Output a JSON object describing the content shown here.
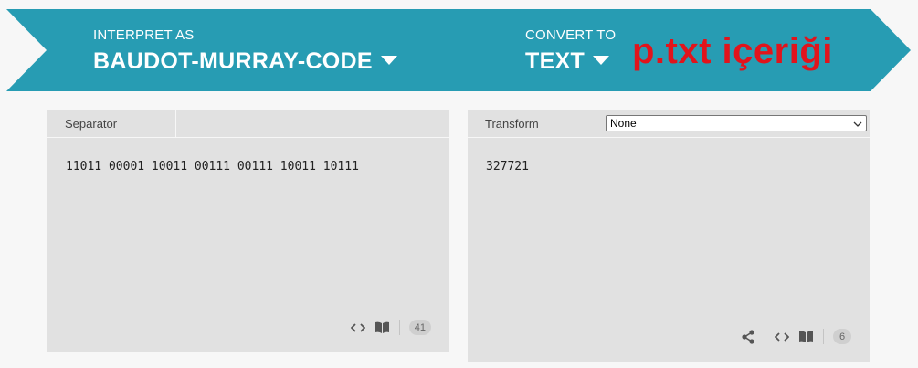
{
  "banner": {
    "interpret_label": "INTERPRET AS",
    "interpret_value": "BAUDOT-MURRAY-CODE",
    "convert_label": "CONVERT TO",
    "convert_value": "TEXT",
    "overlay_text": "p.txt içeriği",
    "color": "#279cb3",
    "overlay_color": "#e1141c"
  },
  "input_panel": {
    "header_label": "Separator",
    "content": "11011 00001 10011 00111 00111 10011 10111",
    "char_count": "41",
    "icons": [
      "code-icon",
      "book-icon"
    ]
  },
  "output_panel": {
    "header_label": "Transform",
    "transform_selected": "None",
    "content": "327721",
    "char_count": "6",
    "icons": [
      "share-icon",
      "code-icon",
      "book-icon"
    ]
  }
}
